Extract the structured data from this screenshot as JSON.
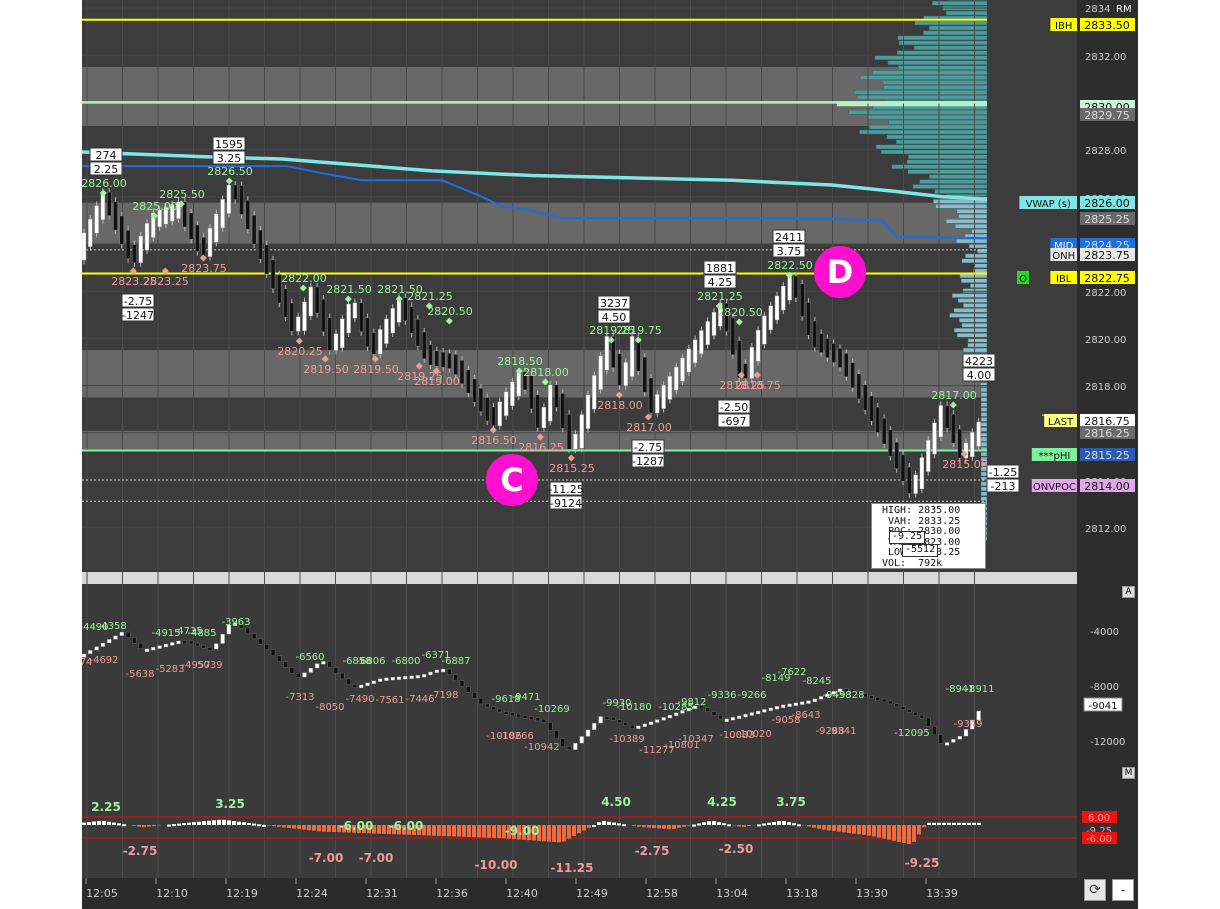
{
  "colors": {
    "bg": "#3a3a3a",
    "band": "#707070",
    "axis": "#2b2b2b",
    "ibh": "#ffff00",
    "green": "#7cf09a",
    "vwap": "#7fe6e6",
    "blue": "#1f6fe0",
    "up": "#ffffff",
    "down": "#111111",
    "hi": "#9bf59b",
    "lo": "#f29a9a",
    "profile": "#5aa6a6",
    "delta": "#f06a40",
    "red": "#cc1111",
    "magenta": "#ff10d0"
  },
  "header": {
    "rm_label": "RM"
  },
  "price_axis": {
    "ticks": [
      "2834",
      "2832.00",
      "2830.00",
      "2828.00",
      "2826.00",
      "2822.00",
      "2820.00",
      "2818.00",
      "2814.00",
      "2812.00"
    ]
  },
  "level_tags": [
    {
      "label": "IBH",
      "value": "2833.50",
      "label_bg": "#ffff00",
      "value_bg": "#ffff00"
    },
    {
      "label": "",
      "value": "2830.00",
      "label_bg": "",
      "value_bg": "#c8f5d8"
    },
    {
      "label": "",
      "value": "2829.75",
      "label_bg": "",
      "value_bg": "#6a6a6a"
    },
    {
      "label": "VWAP (s)",
      "value": "2826.00",
      "label_bg": "#7fe6e6",
      "value_bg": "#7fe6e6"
    },
    {
      "label": "",
      "value": "2825.25",
      "label_bg": "",
      "value_bg": "#6a6a6a"
    },
    {
      "label": "MID",
      "value": "2824.25",
      "label_bg": "#1f6fe0",
      "value_bg": "#1f6fe0"
    },
    {
      "label": "ONH",
      "value": "2823.75",
      "label_bg": "#e8e8e8",
      "value_bg": "#e8e8e8"
    },
    {
      "label": "IBL",
      "value": "2822.75",
      "label_bg": "#ffff00",
      "value_bg": "#ffff00",
      "pre": "O"
    },
    {
      "label": "LAST",
      "value": "2816.75",
      "label_bg": "#ffff80",
      "value_bg": "#ffffff"
    },
    {
      "label": "",
      "value": "2816.25",
      "label_bg": "",
      "value_bg": "#6a6a6a"
    },
    {
      "label": "***pHI",
      "value": "2815.25",
      "label_bg": "#7cf09a",
      "value_bg": "#2b5bb0"
    },
    {
      "label": "ONVPOC",
      "value": "2814.00",
      "label_bg": "#e0a8e8",
      "value_bg": "#e0a8e8"
    }
  ],
  "annotations": {
    "highs": [
      "2826.00",
      "2825.00",
      "2825.50",
      "2826.50",
      "2822.00",
      "2821.50",
      "2821.50",
      "2821.25",
      "2820.50",
      "2818.50",
      "2818.00",
      "2819.25",
      "2819.75",
      "2821.25",
      "2820.50",
      "2822.50",
      "2817.00"
    ],
    "lows": [
      "2823.25",
      "2823.25",
      "2823.75",
      "2820.25",
      "2819.50",
      "2819.50",
      "2819.25",
      "2819.00",
      "2816.50",
      "2816.25",
      "2815.25",
      "2818.00",
      "2817.00",
      "2818.25",
      "2818.75",
      "2815.00"
    ],
    "volume_boxes": [
      {
        "vol": "274",
        "range": "2.25"
      },
      {
        "vol": "1595",
        "range": "3.25"
      },
      {
        "vol": "3237",
        "range": "4.50"
      },
      {
        "vol": "1881",
        "range": "4.25"
      },
      {
        "vol": "2411",
        "range": "3.75"
      },
      {
        "vol": "4223",
        "range": "4.00"
      }
    ],
    "down_boxes": [
      {
        "range": "-2.75",
        "vol": "-1247"
      },
      {
        "range": "-2.50",
        "vol": "-697"
      },
      {
        "range": "-2.75",
        "vol": "-1287"
      },
      {
        "range": "-11.25",
        "vol": "-9124"
      },
      {
        "range": "-1.25",
        "vol": "-213"
      }
    ],
    "markers": [
      "C",
      "D"
    ]
  },
  "stats_box": {
    "lines": [
      "HIGH: 2835.00",
      "VAH: 2833.25",
      "POC: 2830.00",
      "VAL: 2823.00",
      "LOW: 2813.25",
      "VOL:  792k"
    ],
    "overlay": [
      "-9.25",
      "-5512"
    ]
  },
  "cum_delta": {
    "axis": [
      "-4000",
      "-8000",
      "-12000"
    ],
    "current": "-9041",
    "corner": "A",
    "highs": [
      "-4490",
      "4358",
      "-4915",
      "4735",
      "-4885",
      "-3963",
      "-6560",
      "-6858",
      "-6806",
      "-6800",
      "-6371",
      "-6887",
      "-9618",
      "-9471",
      "-10269",
      "-9930",
      "-10180",
      "-10285",
      "-9812",
      "-9336",
      "-9266",
      "-8149",
      "-7622",
      "-8245",
      "-9458",
      "-9328",
      "-12095",
      "-8941",
      "-8911"
    ],
    "lows": [
      "74",
      "-4692",
      "-5638",
      "-5283",
      "-4957",
      "-5039",
      "-7313",
      "-8050",
      "-7490",
      "-7561",
      "-7446",
      "-7198",
      "-10186",
      "-10266",
      "-10942",
      "-10389",
      "-11277",
      "-10801",
      "-10347",
      "-10033",
      "-10020",
      "-9058",
      "-8643",
      "-9288",
      "-9341",
      "-9349"
    ]
  },
  "osc": {
    "corner": "M",
    "highs": [
      "2.25",
      "3.25",
      "-6.00",
      "-6.00",
      "-9.00",
      "4.50",
      "4.25",
      "3.75"
    ],
    "lows": [
      "-2.75",
      "-7.00",
      "-7.00",
      "-10.00",
      "-11.25",
      "-2.75",
      "-2.50",
      "-9.25"
    ],
    "tags": [
      "6.00",
      "-9.25",
      "-6.00"
    ]
  },
  "time_axis": [
    "12:05",
    "12:10",
    "12:19",
    "12:24",
    "12:31",
    "12:36",
    "12:40",
    "12:49",
    "12:58",
    "13:04",
    "13:18",
    "13:30",
    "13:39"
  ],
  "controls": {
    "reset_glyph": "⟳",
    "minus_glyph": "-"
  }
}
